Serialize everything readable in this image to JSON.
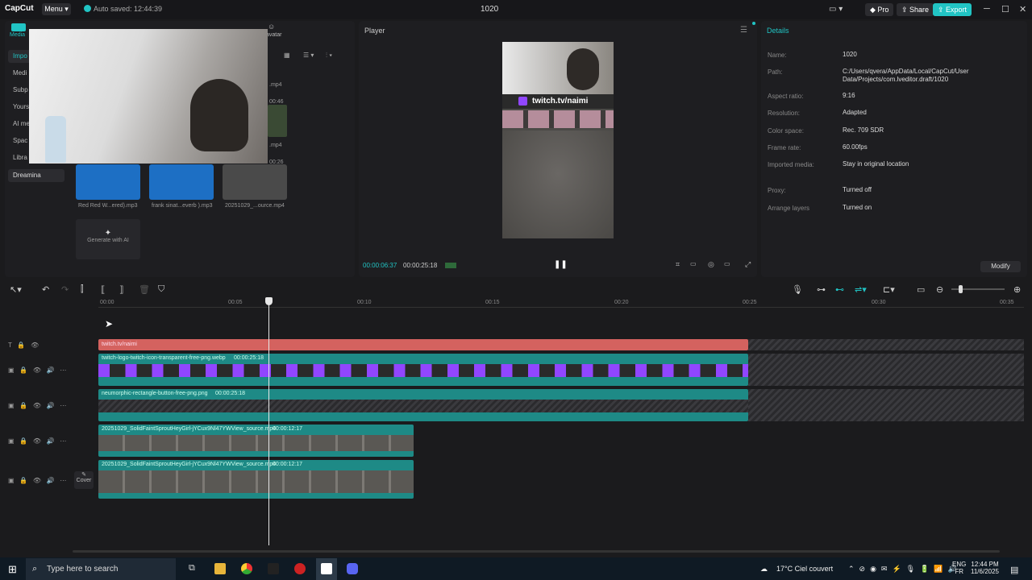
{
  "titlebar": {
    "app_name": "CapCut",
    "menu_label": "Menu",
    "autosave": "Auto saved: 12:44:39",
    "project_title": "1020",
    "pro_label": "Pro",
    "share_label": "Share",
    "export_label": "Export"
  },
  "media": {
    "tab_media": "Media",
    "tab_avatar": "avatar",
    "sidebar": [
      "Impo",
      "Medi",
      "Subp",
      "Yours",
      "AI me",
      "Spac",
      "Libra",
      "Dreamina"
    ],
    "files": [
      {
        "name": "Red Red W...ered).mp3"
      },
      {
        "name": "frank sinat...everb ).mp3"
      },
      {
        "name": "20251029_...ource.mp4"
      }
    ],
    "file_badges": [
      ".mp4",
      "00:46",
      ".mp4",
      "00:26"
    ],
    "generate_label": "Generate with AI"
  },
  "player": {
    "title": "Player",
    "overlay_text": "twitch.tv/naimi",
    "current_time": "00:00:06:37",
    "total_time": "00:00:25:18"
  },
  "details": {
    "title": "Details",
    "rows": [
      {
        "label": "Name:",
        "value": "1020"
      },
      {
        "label": "Path:",
        "value": "C:/Users/qvera/AppData/Local/CapCut/User Data/Projects/com.lveditor.draft/1020"
      },
      {
        "label": "Aspect ratio:",
        "value": "9:16"
      },
      {
        "label": "Resolution:",
        "value": "Adapted"
      },
      {
        "label": "Color space:",
        "value": "Rec. 709 SDR"
      },
      {
        "label": "Frame rate:",
        "value": "60.00fps"
      },
      {
        "label": "Imported media:",
        "value": "Stay in original location"
      },
      {
        "label": "Proxy:",
        "value": "Turned off"
      },
      {
        "label": "Arrange layers",
        "value": "Turned on"
      }
    ],
    "modify_label": "Modify"
  },
  "timeline": {
    "ruler": [
      "00:00",
      "00:05",
      "00:10",
      "00:15",
      "00:20",
      "00:25",
      "00:30",
      "00:35"
    ],
    "tracks": [
      {
        "label": "twitch.tv/naimi",
        "duration": ""
      },
      {
        "label": "twitch-logo-twitch-icon-transparent-free-png.webp",
        "duration": "00:00:25:18"
      },
      {
        "label": "neumorphic-rectangle-button-free-png.png",
        "duration": "00:00:25:18"
      },
      {
        "label": "20251029_SolidFaintSproutHeyGirl-jYCux9Nl47YWView_source.mp4",
        "duration": "00:00:12:17"
      },
      {
        "label": "20251029_SolidFaintSproutHeyGirl-jYCux9Nl47YWView_source.mp4",
        "duration": "00:00:12:17"
      }
    ],
    "cover_label": "Cover"
  },
  "taskbar": {
    "search_placeholder": "Type here to search",
    "weather": "17°C  Ciel couvert",
    "lang_top": "ENG",
    "lang_bottom": "FR",
    "time": "12:44 PM",
    "date": "11/6/2025"
  },
  "colors": {
    "accent": "#21c4c4",
    "text_clip": "#d4625f",
    "sticker_clip": "#1e8a86",
    "twitch_purple": "#9146ff"
  }
}
